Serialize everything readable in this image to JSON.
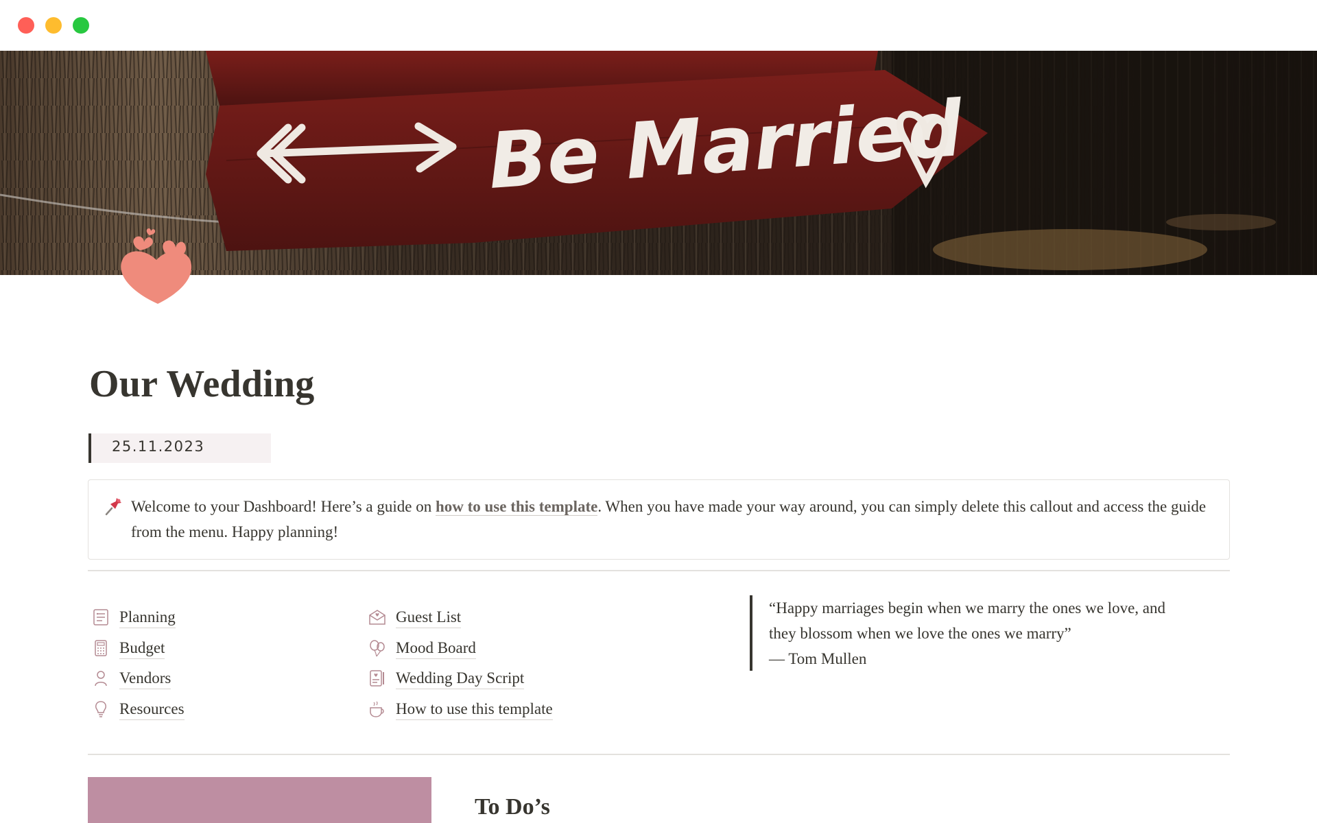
{
  "window": {
    "controls": [
      "close",
      "minimize",
      "maximize"
    ]
  },
  "cover": {
    "sign_text": "Be Married",
    "icon_names": [
      "arrow-icon",
      "heart-icon"
    ]
  },
  "page": {
    "icon": "hearts-icon",
    "title": "Our Wedding",
    "date": "25.11.2023"
  },
  "callout": {
    "icon": "pushpin-icon",
    "text_before": "Welcome to your Dashboard! Here’s a guide on ",
    "link_text": "how to use this template",
    "text_after": ". When you have made your way around, you can simply delete this callout and access the guide from the menu. Happy planning!"
  },
  "nav": {
    "left": [
      {
        "label": "Planning",
        "icon": "planner-icon"
      },
      {
        "label": "Budget",
        "icon": "calculator-icon"
      },
      {
        "label": "Vendors",
        "icon": "person-icon"
      },
      {
        "label": "Resources",
        "icon": "lightbulb-icon"
      }
    ],
    "right": [
      {
        "label": "Guest List",
        "icon": "envelope-heart-icon"
      },
      {
        "label": "Mood Board",
        "icon": "balloons-icon"
      },
      {
        "label": "Wedding Day Script",
        "icon": "script-icon"
      },
      {
        "label": "How to use this template",
        "icon": "coffee-cup-icon"
      }
    ]
  },
  "quote": {
    "text": "“Happy marriages begin when we marry the ones we love, and they blossom when we love the ones we marry”",
    "author": "— Tom Mullen"
  },
  "sections": {
    "todo_heading": "To Do’s"
  },
  "colors": {
    "accent_rose": "#be8ea2",
    "heart_coral": "#ef8b7c",
    "text": "#37352f",
    "date_bg": "#f6f1f2"
  }
}
